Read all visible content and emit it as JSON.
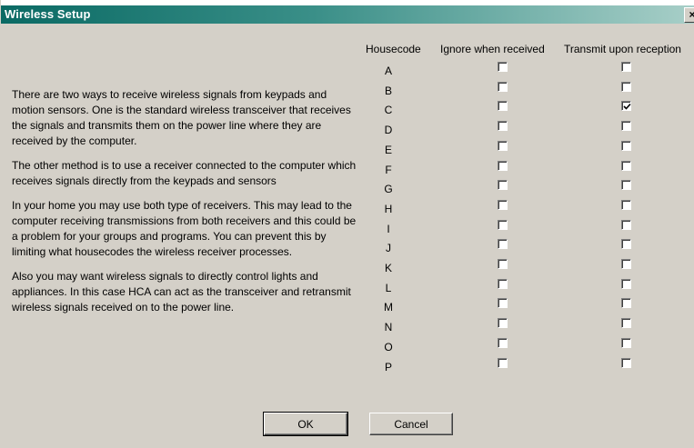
{
  "window": {
    "title": "Wireless Setup",
    "close_glyph": "×"
  },
  "description": {
    "paragraphs": [
      "There are two ways to receive wireless signals from keypads and motion sensors.  One is the standard wireless transceiver that receives the signals and transmits them on the power line where they are received by the computer.",
      "The other method is to use a receiver connected to the computer which receives signals directly from the keypads and sensors",
      "In your home you may use both type of receivers.  This may lead to the computer receiving transmissions from both receivers and this could be a problem for your groups and programs.  You can prevent this by limiting what housecodes the wireless receiver processes.",
      "Also you may want wireless signals to directly control lights and appliances.  In this case HCA can act as the transceiver and retransmit wireless signals received on to the power line."
    ]
  },
  "table": {
    "headers": {
      "housecode": "Housecode",
      "ignore": "Ignore when received",
      "transmit": "Transmit upon reception"
    },
    "rows": [
      {
        "code": "A",
        "ignore": false,
        "transmit": false
      },
      {
        "code": "B",
        "ignore": false,
        "transmit": false
      },
      {
        "code": "C",
        "ignore": false,
        "transmit": true
      },
      {
        "code": "D",
        "ignore": false,
        "transmit": false
      },
      {
        "code": "E",
        "ignore": false,
        "transmit": false
      },
      {
        "code": "F",
        "ignore": false,
        "transmit": false
      },
      {
        "code": "G",
        "ignore": false,
        "transmit": false
      },
      {
        "code": "H",
        "ignore": false,
        "transmit": false
      },
      {
        "code": "I",
        "ignore": false,
        "transmit": false
      },
      {
        "code": "J",
        "ignore": false,
        "transmit": false
      },
      {
        "code": "K",
        "ignore": false,
        "transmit": false
      },
      {
        "code": "L",
        "ignore": false,
        "transmit": false
      },
      {
        "code": "M",
        "ignore": false,
        "transmit": false
      },
      {
        "code": "N",
        "ignore": false,
        "transmit": false
      },
      {
        "code": "O",
        "ignore": false,
        "transmit": false
      },
      {
        "code": "P",
        "ignore": false,
        "transmit": false
      }
    ]
  },
  "buttons": {
    "ok": "OK",
    "cancel": "Cancel"
  },
  "colors": {
    "title_start": "#0a6a64",
    "title_end": "#a8cfc8",
    "face": "#d4d0c8"
  }
}
